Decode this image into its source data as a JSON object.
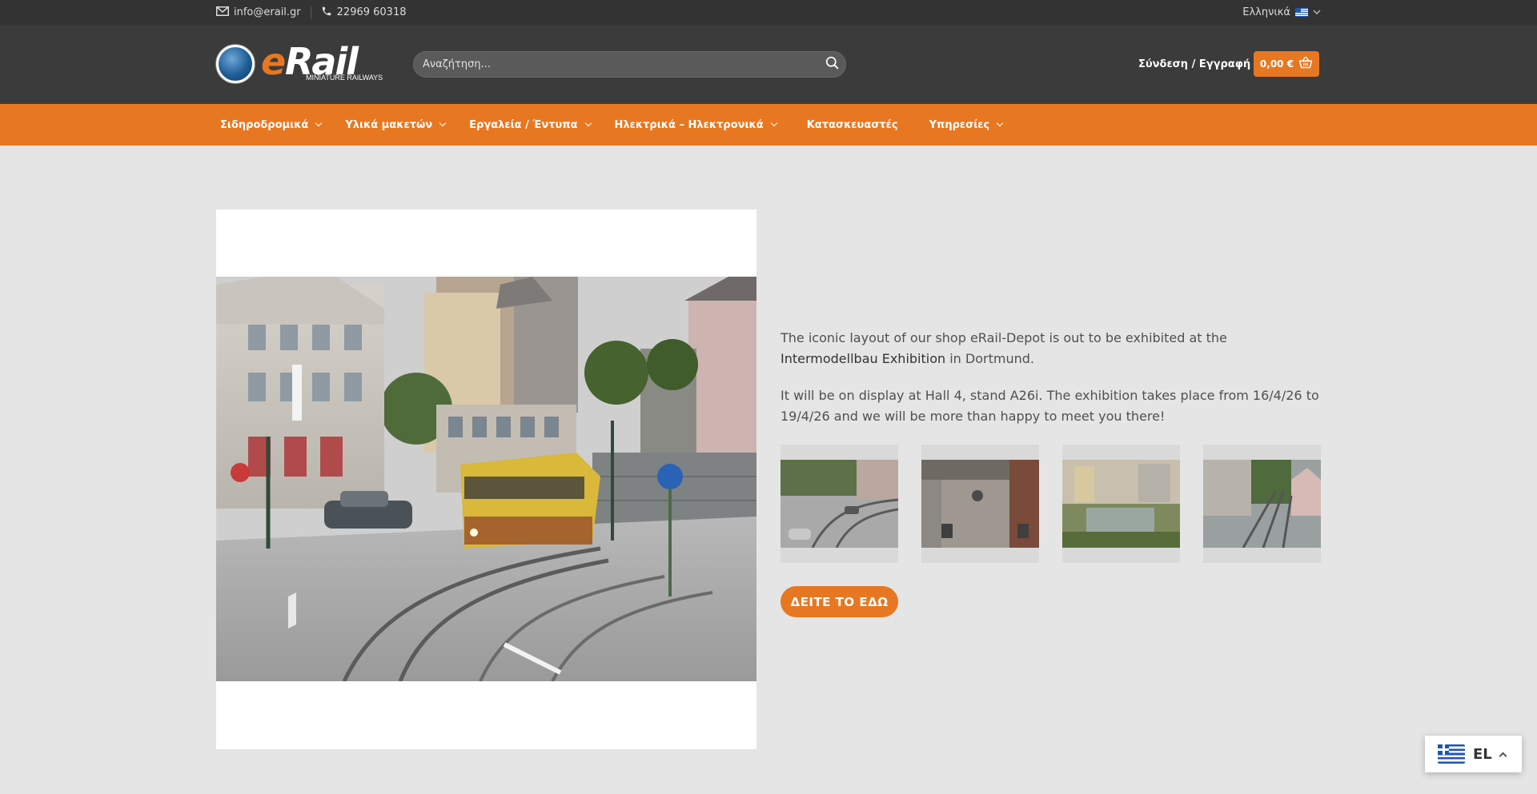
{
  "topbar": {
    "email": "info@erail.gr",
    "phone": "22969 60318",
    "language": "Ελληνικά"
  },
  "header": {
    "logo_main": "eRail",
    "logo_sub": "MINIATURE RAILWAYS",
    "search_placeholder": "Αναζήτηση...",
    "account_label": "Σύνδεση / Εγγραφή",
    "cart_total": "0,00 €"
  },
  "nav": {
    "items": [
      {
        "label": "Σιδηροδρομικά",
        "has_dropdown": true
      },
      {
        "label": "Υλικά μακετών",
        "has_dropdown": true
      },
      {
        "label": "Εργαλεία / Έντυπα",
        "has_dropdown": true
      },
      {
        "label": "Ηλεκτρικά – Ηλεκτρονικά",
        "has_dropdown": true
      },
      {
        "label": "Κατασκευαστές",
        "has_dropdown": false
      },
      {
        "label": "Υπηρεσίες",
        "has_dropdown": true
      }
    ]
  },
  "content": {
    "p1_a": "The iconic layout of our shop eRail-Depot is out to be exhibited at the ",
    "p1_b": "Intermodellbau Exhibition",
    "p1_c": " in Dortmund.",
    "p2": "It will be on display at Hall 4, stand A26i. The exhibition takes place from 16/4/26 to 19/4/26 and we will be more than happy to meet you there!",
    "cta_label": "ΔΕΙΤΕ ΤΟ ΕΔΩ"
  },
  "language_switcher": {
    "code": "EL"
  },
  "colors": {
    "accent": "#e87722",
    "header_bg": "#3b3b3b",
    "topbar_bg": "#333333",
    "page_bg": "#e5e5e5"
  },
  "icons": [
    "mail-icon",
    "phone-icon",
    "flag-greece-icon",
    "search-icon",
    "cart-icon",
    "chevron-down-icon",
    "chevron-up-icon"
  ]
}
